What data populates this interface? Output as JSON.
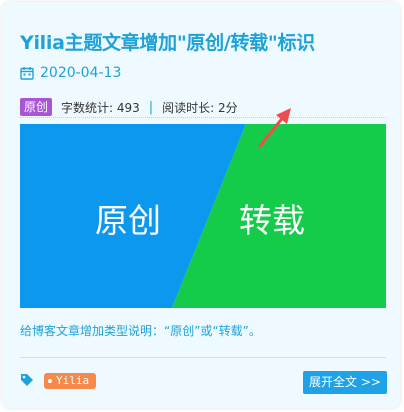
{
  "post": {
    "title": "Yilia主题文章增加\"原创/转载\"标识",
    "date": "2020-04-13",
    "type_badge": "原创",
    "word_count": "字数统计: 493",
    "separator": "|",
    "read_time": "阅读时长: 2分",
    "cover": {
      "left_text": "原创",
      "right_text": "转载",
      "left_color": "#0b98ee",
      "right_color": "#15cc4a"
    },
    "summary": "给博客文章增加类型说明：“原创”或“转载”。",
    "tag": "Yilia",
    "more_button": "展开全文 >>"
  },
  "colors": {
    "accent": "#1fa2d8",
    "badge": "#a855d6",
    "tag": "#f7894a",
    "button": "#1fa2e8",
    "arrow": "#f24b4b"
  },
  "icons": [
    "calendar-icon",
    "tag-icon",
    "red-arrow-annotation"
  ]
}
